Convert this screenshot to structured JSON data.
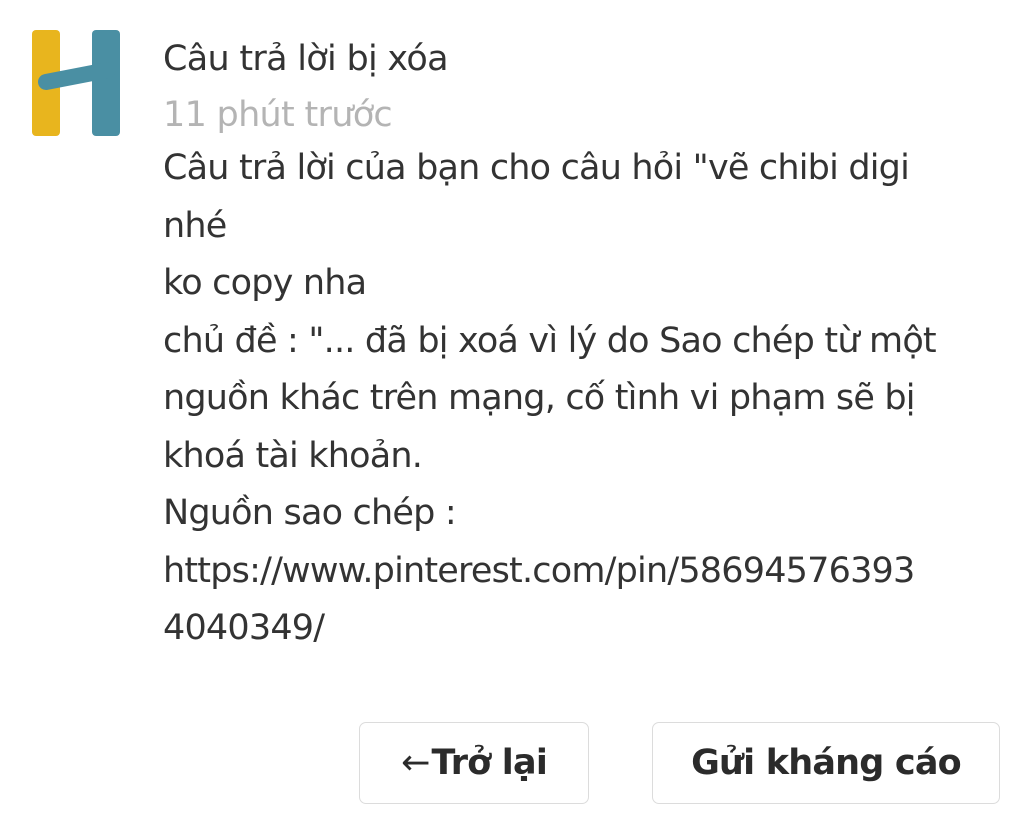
{
  "notification": {
    "title": "Câu trả lời bị xóa",
    "time": "11 phút trước",
    "body_lines": [
      "Câu trả lời của bạn cho câu hỏi \"vẽ chibi digi",
      "nhé",
      "ko copy nha",
      "chủ đề :  \"... đã bị xoá vì lý do Sao chép từ một",
      "nguồn khác trên mạng, cố tình vi phạm sẽ bị",
      "khoá tài khoản.",
      "Nguồn sao chép :",
      "https://www.pinterest.com/pin/58694576393",
      "4040349/"
    ]
  },
  "buttons": {
    "back_arrow": "←",
    "back_label": "Trở lại",
    "appeal_label": "Gửi kháng cáo"
  },
  "icons": {
    "logo": "h-logo-icon"
  },
  "colors": {
    "logo_yellow": "#E8B51E",
    "logo_teal": "#4A8FA3",
    "timestamp": "#B4B4B4"
  }
}
